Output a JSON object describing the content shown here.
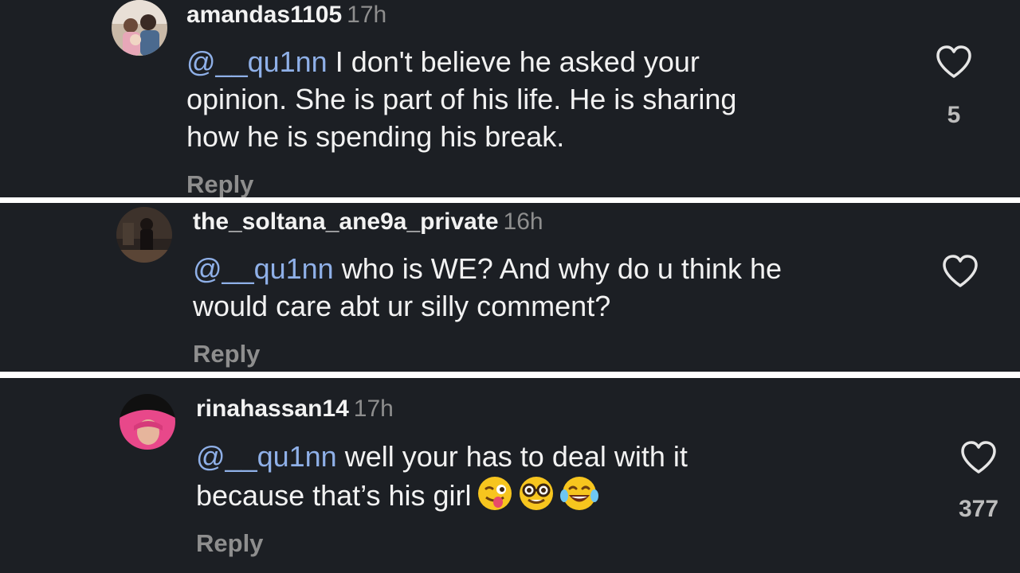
{
  "comments": [
    {
      "username": "amandas1105",
      "time": "17h",
      "mention": "@__qu1nn",
      "lines": [
        " I don't believe he asked your",
        "opinion. She is part of his life. He is sharing",
        "how he is spending his break."
      ],
      "reply": "Reply",
      "likes": "5",
      "icon": "heart-outline-icon"
    },
    {
      "username": "the_soltana_ane9a_private",
      "time": "16h",
      "mention": "@__qu1nn",
      "lines": [
        " who is WE? And why do u think he",
        "would care abt ur silly comment?"
      ],
      "reply": "Reply",
      "likes": "",
      "icon": "heart-outline-icon"
    },
    {
      "username": "rinahassan14",
      "time": "17h",
      "mention": "@__qu1nn",
      "lines": [
        " well your has to deal with it",
        "because that’s his girl"
      ],
      "emojis": [
        "winking-face-with-tongue-emoji",
        "nerd-face-emoji",
        "face-with-tears-of-joy-emoji"
      ],
      "reply": "Reply",
      "likes": "377",
      "icon": "heart-outline-icon"
    }
  ],
  "colors": {
    "panel_bg": "#1c1f24",
    "separator": "#ffffff",
    "text": "#f2f2f2",
    "secondary": "#8e8e8e",
    "mention": "#8fb0e8"
  }
}
